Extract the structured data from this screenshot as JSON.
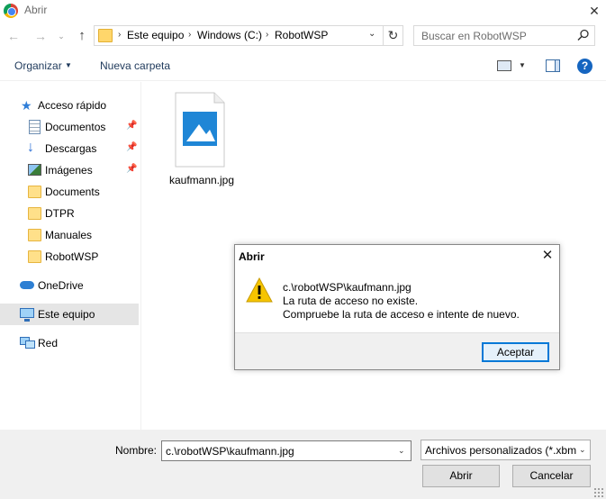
{
  "window": {
    "title": "Abrir",
    "icon": "chrome-icon",
    "close_glyph": "✕"
  },
  "navigation": {
    "back_glyph": "←",
    "forward_glyph": "→",
    "recent_glyph": "⌄",
    "up_glyph": "↑",
    "refresh_glyph": "↻"
  },
  "address_bar": {
    "breadcrumbs": [
      "Este equipo",
      "Windows (C:)",
      "RobotWSP"
    ],
    "separator": "›",
    "dropdown_glyph": "⌄"
  },
  "search": {
    "placeholder": "Buscar en RobotWSP",
    "icon": "search-icon"
  },
  "toolbar": {
    "organize_label": "Organizar",
    "organize_caret": "▼",
    "new_folder_label": "Nueva carpeta",
    "view_caret": "▼",
    "help_glyph": "?"
  },
  "sidebar": {
    "pin_glyph": "📌",
    "items": [
      {
        "label": "Acceso rápido",
        "icon": "star-icon"
      },
      {
        "label": "Documentos",
        "icon": "documents-icon",
        "pinned": true
      },
      {
        "label": "Descargas",
        "icon": "downloads-icon",
        "pinned": true
      },
      {
        "label": "Imágenes",
        "icon": "pictures-icon",
        "pinned": true
      },
      {
        "label": "Documents",
        "icon": "folder-icon"
      },
      {
        "label": "DTPR",
        "icon": "folder-icon"
      },
      {
        "label": "Manuales",
        "icon": "folder-icon"
      },
      {
        "label": "RobotWSP",
        "icon": "folder-icon"
      },
      {
        "label": "OneDrive",
        "icon": "onedrive-icon"
      },
      {
        "label": "Este equipo",
        "icon": "computer-icon",
        "selected": true
      },
      {
        "label": "Red",
        "icon": "network-icon"
      }
    ]
  },
  "files": [
    {
      "name": "kaufmann.jpg",
      "icon": "image-file-icon"
    }
  ],
  "error_dialog": {
    "title": "Abrir",
    "close_glyph": "✕",
    "icon": "warning-icon",
    "lines": [
      "c.\\robotWSP\\kaufmann.jpg",
      "La ruta de acceso no existe.",
      "Compruebe la ruta de acceso e intente de nuevo."
    ],
    "accept_label": "Aceptar"
  },
  "footer": {
    "name_label": "Nombre:",
    "filename_value": "c.\\robotWSP\\kaufmann.jpg",
    "dropdown_glyph": "⌄",
    "filetype_value": "Archivos personalizados (*.xbm",
    "open_label": "Abrir",
    "cancel_label": "Cancelar"
  },
  "colors": {
    "accent": "#0078d7",
    "toolbar_text": "#1e395b",
    "selected_bg": "#e5e5e5",
    "footer_bg": "#f0f0f0",
    "warning": "#f2c200"
  }
}
